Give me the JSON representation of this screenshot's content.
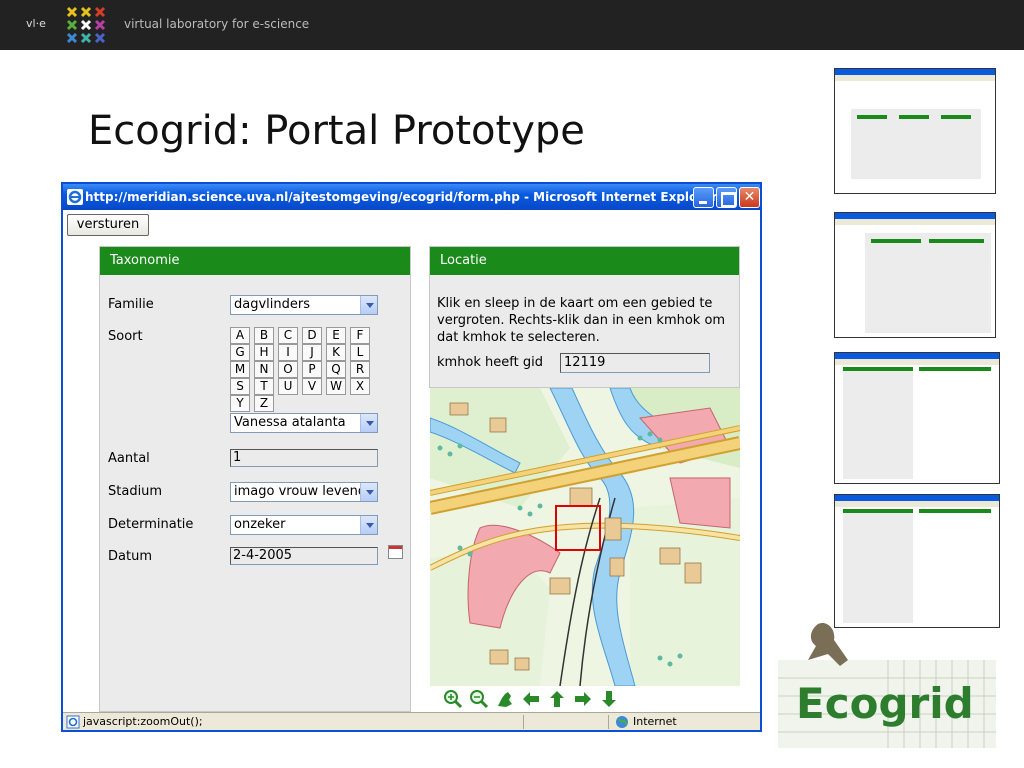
{
  "banner": {
    "brand": "vl·e",
    "tagline": "virtual laboratory for e-science"
  },
  "slide": {
    "title": "Ecogrid: Portal Prototype"
  },
  "window": {
    "title": "http://meridian.science.uva.nl/ajtestomgeving/ecogrid/form.php - Microsoft Internet Explorer"
  },
  "form": {
    "submit_label": "versturen",
    "taxonomy": {
      "header": "Taxonomie",
      "family_label": "Familie",
      "family_value": "dagvlinders",
      "species_label": "Soort",
      "letters": [
        "A",
        "B",
        "C",
        "D",
        "E",
        "F",
        "G",
        "H",
        "I",
        "J",
        "K",
        "L",
        "M",
        "N",
        "O",
        "P",
        "Q",
        "R",
        "S",
        "T",
        "U",
        "V",
        "W",
        "X",
        "Y",
        "Z"
      ],
      "species_value": "Vanessa atalanta",
      "count_label": "Aantal",
      "count_value": "1",
      "stage_label": "Stadium",
      "stage_value": "imago vrouw levend",
      "determination_label": "Determinatie",
      "determination_value": "onzeker",
      "date_label": "Datum",
      "date_value": "2-4-2005"
    },
    "location": {
      "header": "Locatie",
      "instructions": "Klik en sleep in de kaart om een gebied te vergroten. Rechts-klik dan in een kmhok om dat kmhok te selecteren.",
      "gid_label": "kmhok heeft gid",
      "gid_value": "12119"
    },
    "map_tools": [
      "zoom-in-icon",
      "zoom-out-icon",
      "pan-hand-icon",
      "arrow-left-icon",
      "arrow-up-icon",
      "arrow-right-icon",
      "arrow-down-icon"
    ]
  },
  "statusbar": {
    "text": "javascript:zoomOut();",
    "zone": "Internet"
  },
  "logo": {
    "text": "Ecogrid"
  },
  "colors": {
    "panel_header": "#1a8a1a",
    "titlebar": "#0a5ae0",
    "banner": "#222222"
  }
}
